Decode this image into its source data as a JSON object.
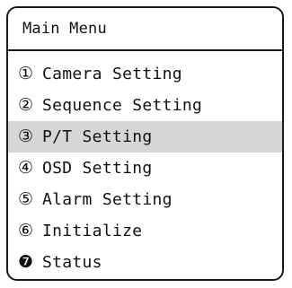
{
  "menu": {
    "title": "Main Menu",
    "selected_index": 2,
    "items": [
      {
        "number": "①",
        "label": "Camera Setting"
      },
      {
        "number": "②",
        "label": "Sequence Setting"
      },
      {
        "number": "③",
        "label": "P/T Setting"
      },
      {
        "number": "④",
        "label": "OSD Setting"
      },
      {
        "number": "⑤",
        "label": "Alarm Setting"
      },
      {
        "number": "⑥",
        "label": "Initialize"
      },
      {
        "number": "❼",
        "label": "Status"
      }
    ]
  }
}
